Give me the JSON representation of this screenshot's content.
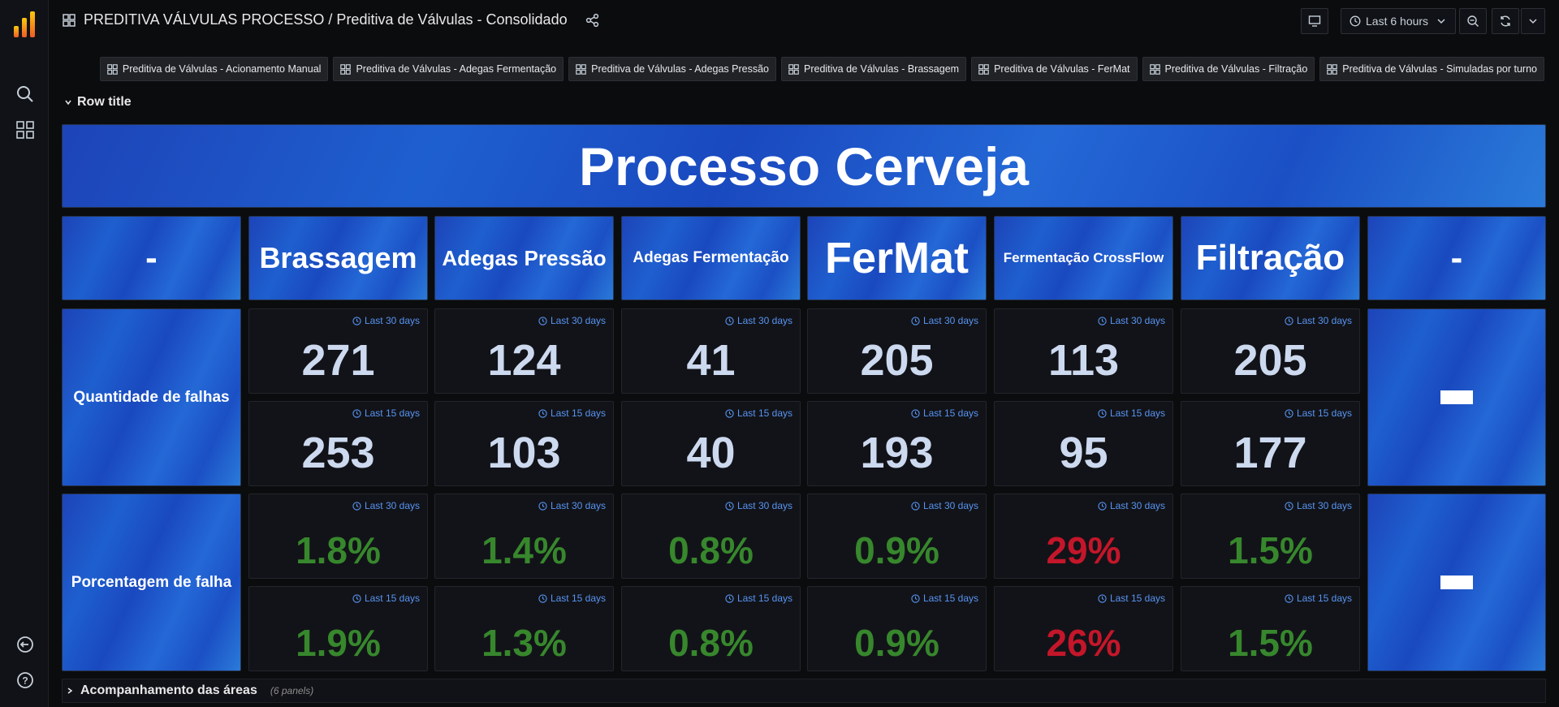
{
  "breadcrumb": "PREDITIVA VÁLVULAS PROCESSO / Preditiva de Válvulas - Consolidado",
  "time_range": "Last 6 hours",
  "links": [
    "Preditiva de Válvulas - Acionamento Manual",
    "Preditiva de Válvulas - Adegas Fermentação",
    "Preditiva de Válvulas - Adegas Pressão",
    "Preditiva de Válvulas - Brassagem",
    "Preditiva de Válvulas - FerMat",
    "Preditiva de Válvulas - Filtração",
    "Preditiva de Válvulas - Simuladas por turno"
  ],
  "row_title": "Row title",
  "banner": "Processo Cerveja",
  "headers": [
    "-",
    "Brassagem",
    "Adegas Pressão",
    "Adegas Fermentação",
    "FerMat",
    "Fermentação CrossFlow",
    "Filtração",
    "-"
  ],
  "row_labels": {
    "falhas": "Quantidade de falhas",
    "porcentagem": "Porcentagem de falha"
  },
  "right_placeholder": "-",
  "stats": {
    "falhas_30": {
      "label": "Last 30 days",
      "values": [
        "271",
        "124",
        "41",
        "205",
        "113",
        "205"
      ]
    },
    "falhas_15": {
      "label": "Last 15 days",
      "values": [
        "253",
        "103",
        "40",
        "193",
        "95",
        "177"
      ]
    },
    "pct_30": {
      "label": "Last 30 days",
      "values": [
        "1.8%",
        "1.4%",
        "0.8%",
        "0.9%",
        "29%",
        "1.5%"
      ],
      "colors": [
        "green",
        "green",
        "green",
        "green",
        "red",
        "green"
      ]
    },
    "pct_15": {
      "label": "Last 15 days",
      "values": [
        "1.9%",
        "1.3%",
        "0.8%",
        "0.9%",
        "26%",
        "1.5%"
      ],
      "colors": [
        "green",
        "green",
        "green",
        "green",
        "red",
        "green"
      ]
    }
  },
  "bottom_row": {
    "title": "Acompanhamento das áreas",
    "count": "(6 panels)"
  },
  "colors": {
    "ok": "#37872d",
    "bad": "#c4162a",
    "accent": "#5794f2",
    "panel_blue": "#1e5fcf"
  }
}
